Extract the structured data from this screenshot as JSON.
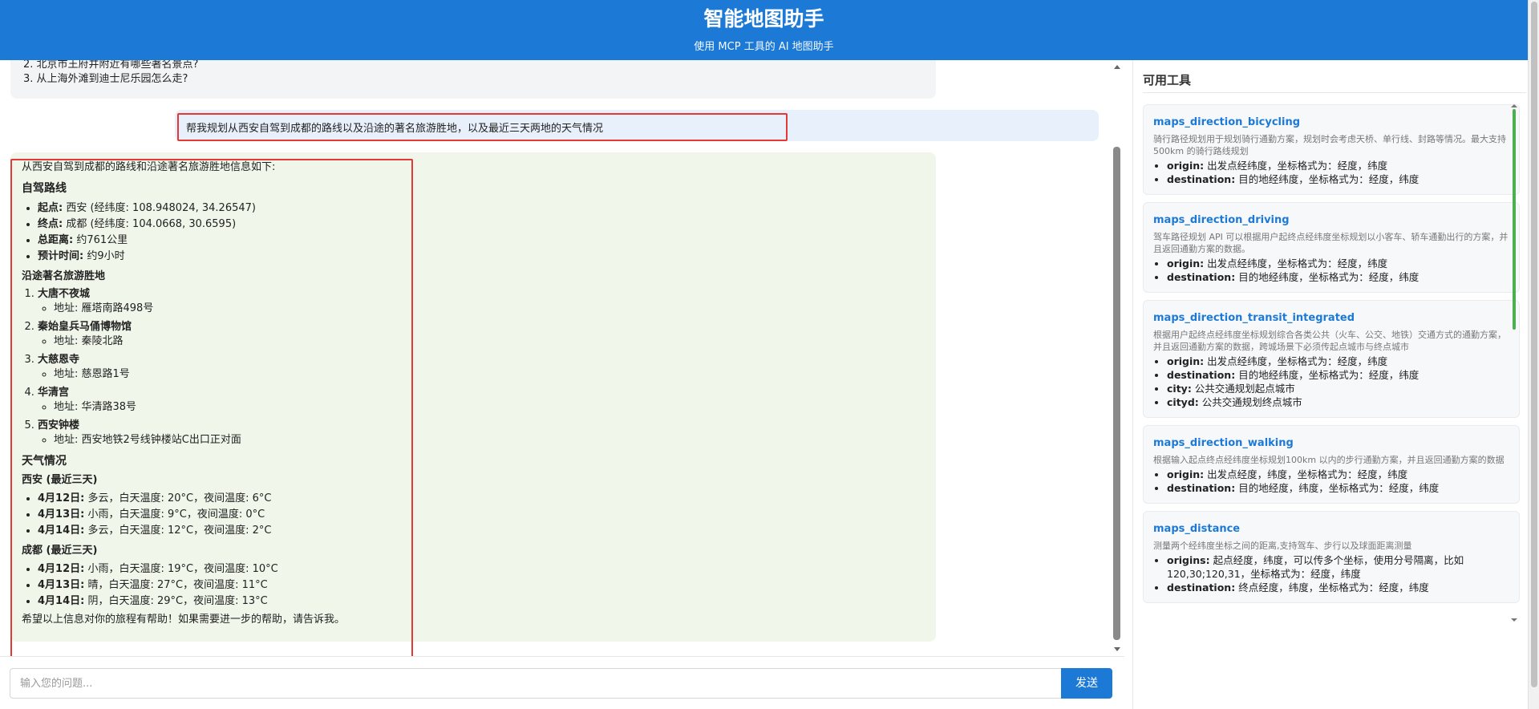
{
  "header": {
    "title": "智能地图助手",
    "subtitle": "使用 MCP 工具的 AI 地图助手"
  },
  "chat": {
    "previous_examples": [
      "2. 北京市王府井附近有哪些著名景点?",
      "3. 从上海外滩到迪士尼乐园怎么走?"
    ],
    "user_message": "帮我规划从西安自驾到成都的路线以及沿途的著名旅游胜地，以及最近三天两地的天气情况",
    "reply": {
      "intro": "从西安自驾到成都的路线和沿途著名旅游胜地信息如下:",
      "route_heading": "自驾路线",
      "route": [
        {
          "label": "起点:",
          "value": " 西安 (经纬度: 108.948024, 34.26547)"
        },
        {
          "label": "终点:",
          "value": " 成都 (经纬度: 104.0668, 30.6595)"
        },
        {
          "label": "总距离:",
          "value": " 约761公里"
        },
        {
          "label": "预计时间:",
          "value": " 约9小时"
        }
      ],
      "sites_heading": "沿途著名旅游胜地",
      "sites": [
        {
          "name": "大唐不夜城",
          "address": "地址: 雁塔南路498号"
        },
        {
          "name": "秦始皇兵马俑博物馆",
          "address": "地址: 秦陵北路"
        },
        {
          "name": "大慈恩寺",
          "address": "地址: 慈恩路1号"
        },
        {
          "name": "华清宫",
          "address": "地址: 华清路38号"
        },
        {
          "name": "西安钟楼",
          "address": "地址: 西安地铁2号线钟楼站C出口正对面"
        }
      ],
      "weather_heading": "天气情况",
      "xian_heading": "西安 (最近三天)",
      "xian_weather": [
        {
          "date": "4月12日:",
          "text": " 多云，白天温度: 20°C，夜间温度: 6°C"
        },
        {
          "date": "4月13日:",
          "text": " 小雨，白天温度: 9°C，夜间温度: 0°C"
        },
        {
          "date": "4月14日:",
          "text": " 多云，白天温度: 12°C，夜间温度: 2°C"
        }
      ],
      "chengdu_heading": "成都 (最近三天)",
      "chengdu_weather": [
        {
          "date": "4月12日:",
          "text": " 小雨，白天温度: 19°C，夜间温度: 10°C"
        },
        {
          "date": "4月13日:",
          "text": " 晴，白天温度: 27°C，夜间温度: 11°C"
        },
        {
          "date": "4月14日:",
          "text": " 阴，白天温度: 29°C，夜间温度: 13°C"
        }
      ],
      "closing": "希望以上信息对你的旅程有帮助！如果需要进一步的帮助，请告诉我。"
    }
  },
  "input": {
    "placeholder": "输入您的问题...",
    "send_label": "发送"
  },
  "sidebar": {
    "title": "可用工具",
    "tools": [
      {
        "name": "maps_direction_bicycling",
        "desc": "骑行路径规划用于规划骑行通勤方案，规划时会考虑天桥、单行线、封路等情况。最大支持 500km 的骑行路线规划",
        "params": [
          {
            "key": "origin:",
            "text": " 出发点经纬度，坐标格式为：经度，纬度"
          },
          {
            "key": "destination:",
            "text": " 目的地经纬度，坐标格式为：经度，纬度"
          }
        ]
      },
      {
        "name": "maps_direction_driving",
        "desc": "驾车路径规划 API 可以根据用户起终点经纬度坐标规划以小客车、轿车通勤出行的方案，并且返回通勤方案的数据。",
        "params": [
          {
            "key": "origin:",
            "text": " 出发点经纬度，坐标格式为：经度，纬度"
          },
          {
            "key": "destination:",
            "text": " 目的地经纬度，坐标格式为：经度，纬度"
          }
        ]
      },
      {
        "name": "maps_direction_transit_integrated",
        "desc": "根据用户起终点经纬度坐标规划综合各类公共（火车、公交、地铁）交通方式的通勤方案，并且返回通勤方案的数据，跨城场景下必须传起点城市与终点城市",
        "params": [
          {
            "key": "origin:",
            "text": " 出发点经纬度，坐标格式为：经度，纬度"
          },
          {
            "key": "destination:",
            "text": " 目的地经纬度，坐标格式为：经度，纬度"
          },
          {
            "key": "city:",
            "text": " 公共交通规划起点城市"
          },
          {
            "key": "cityd:",
            "text": " 公共交通规划终点城市"
          }
        ]
      },
      {
        "name": "maps_direction_walking",
        "desc": "根据输入起点终点经纬度坐标规划100km 以内的步行通勤方案，并且返回通勤方案的数据",
        "params": [
          {
            "key": "origin:",
            "text": " 出发点经度，纬度，坐标格式为：经度，纬度"
          },
          {
            "key": "destination:",
            "text": " 目的地经度，纬度，坐标格式为：经度，纬度"
          }
        ]
      },
      {
        "name": "maps_distance",
        "desc": "测量两个经纬度坐标之间的距离,支持驾车、步行以及球面距离测量",
        "params": [
          {
            "key": "origins:",
            "text": " 起点经度，纬度，可以传多个坐标，使用分号隔离，比如120,30;120,31，坐标格式为：经度，纬度"
          },
          {
            "key": "destination:",
            "text": " 终点经度，纬度，坐标格式为：经度，纬度"
          }
        ]
      }
    ]
  },
  "colors": {
    "primary": "#1c7ad6",
    "user_bubble": "#e8f1fb",
    "bot_bubble": "#f0f6ea",
    "highlight_box": "#e53935",
    "scroll_indicator": "#4caf50"
  }
}
